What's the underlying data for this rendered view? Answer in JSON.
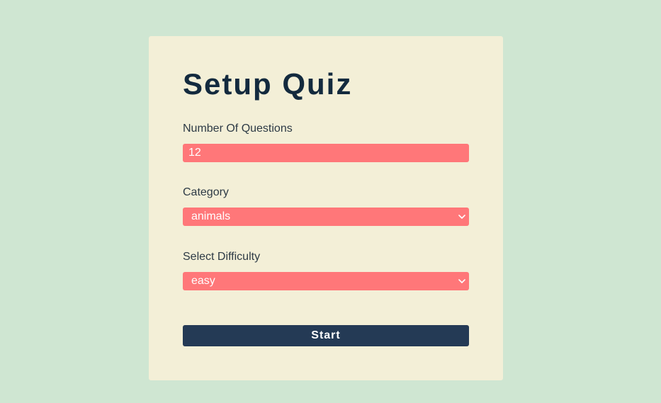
{
  "form": {
    "title": "Setup Quiz",
    "questions": {
      "label": "Number Of Questions",
      "value": "12"
    },
    "category": {
      "label": "Category",
      "selected": "animals"
    },
    "difficulty": {
      "label": "Select Difficulty",
      "selected": "easy"
    },
    "start_label": "Start"
  },
  "colors": {
    "background": "#cfe6d2",
    "card": "#f3efd7",
    "title": "#132a3e",
    "control": "#ff7779",
    "button": "#243a55"
  },
  "icons": {
    "select_arrow": "chevron-down-icon"
  }
}
